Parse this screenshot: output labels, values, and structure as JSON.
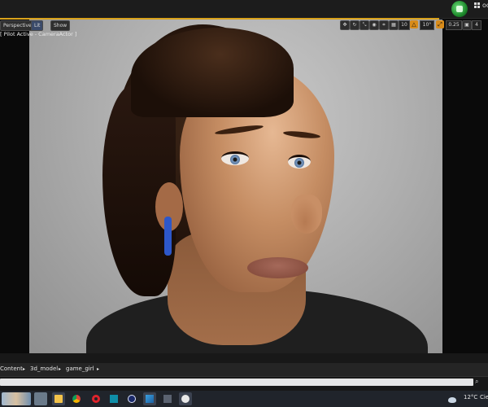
{
  "top_toolbar": {
    "clipped_label": "oo"
  },
  "viewport": {
    "mode_button": "Perspective",
    "lit_button": "Lit",
    "show_button": "Show",
    "pilot_text": "[ Pilot Active - CameraActor ]",
    "grid_snap": "10",
    "rotation_snap": "10°",
    "scale_snap": "0.25",
    "camera_speed": "4"
  },
  "content_browser": {
    "breadcrumbs": [
      "Content",
      "3d_model",
      "game_girl"
    ]
  },
  "taskbar": {
    "apps": [
      "file-explorer",
      "chrome",
      "opera",
      "maya",
      "cinema4d",
      "photos",
      "calculator",
      "unreal-engine"
    ],
    "temperature": "12°C",
    "weather_text": "Ciel"
  },
  "colors": {
    "accent": "#d9a21b",
    "taskbar": "#20242b",
    "earpiece": "#2d57c9"
  }
}
